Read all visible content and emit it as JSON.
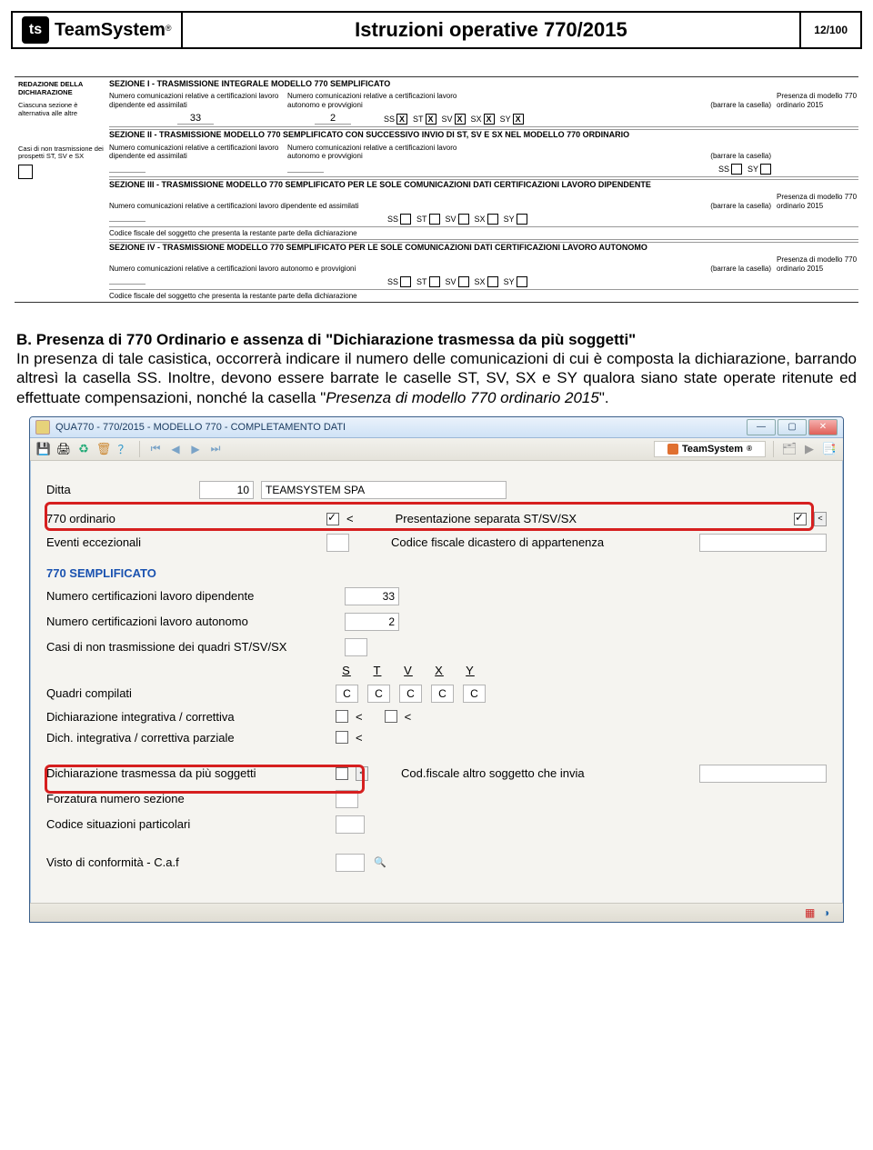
{
  "header": {
    "brand": "TeamSystem",
    "reg": "®",
    "title": "Istruzioni operative 770/2015",
    "page": "12/100"
  },
  "sidebar": {
    "heading": "REDAZIONE DELLA DICHIARAZIONE",
    "note1": "Ciascuna sezione è alternativa alle altre",
    "note2": "Casi di non trasmissione dei prospetti ST, SV e SX"
  },
  "form": {
    "sec1": {
      "title": "SEZIONE I - TRASMISSIONE INTEGRALE MODELLO 770 SEMPLIFICATO",
      "lbl1": "Numero comunicazioni relative a certificazioni lavoro dipendente ed assimilati",
      "val1": "33",
      "lbl2": "Numero comunicazioni relative a certificazioni lavoro autonomo e provvigioni",
      "val2": "2",
      "barrare": "(barrare la casella)",
      "presenza": "Presenza di modello 770 ordinario 2015",
      "ss": "SS",
      "st": "ST",
      "sv": "SV",
      "sx": "SX",
      "sy": "SY"
    },
    "sec2": {
      "title": "SEZIONE II - TRASMISSIONE MODELLO 770 SEMPLIFICATO CON SUCCESSIVO INVIO DI ST, SV E SX NEL MODELLO 770 ORDINARIO",
      "lbl1": "Numero comunicazioni relative a certificazioni lavoro dipendente ed assimilati",
      "lbl2": "Numero comunicazioni relative a certificazioni lavoro autonomo e provvigioni",
      "barrare": "(barrare la casella)"
    },
    "sec3": {
      "title": "SEZIONE III - TRASMISSIONE MODELLO 770 SEMPLIFICATO PER LE SOLE COMUNICAZIONI DATI CERTIFICAZIONI LAVORO DIPENDENTE",
      "lbl": "Numero comunicazioni relative a certificazioni lavoro dipendente ed assimilati",
      "barrare": "(barrare la casella)",
      "presenza": "Presenza di modello 770 ordinario 2015",
      "cf": "Codice fiscale del soggetto che presenta la restante parte della dichiarazione"
    },
    "sec4": {
      "title": "SEZIONE IV - TRASMISSIONE MODELLO 770 SEMPLIFICATO PER LE SOLE COMUNICAZIONI DATI CERTIFICAZIONI LAVORO AUTONOMO",
      "lbl": "Numero comunicazioni relative a certificazioni lavoro autonomo e provvigioni",
      "barrare": "(barrare la casella)",
      "presenza": "Presenza di modello 770 ordinario 2015",
      "cf": "Codice fiscale del soggetto che presenta la restante parte della dichiarazione"
    }
  },
  "body": {
    "lead": "B. Presenza di 770 Ordinario e assenza di \"Dichiarazione trasmessa da più soggetti\"",
    "text1": "In presenza di tale casistica, occorrerà indicare il numero delle comunicazioni di cui è composta la dichiarazione, barrando altresì la casella SS. Inoltre, devono essere barrate le caselle ST, SV, SX e SY qualora siano state operate ritenute ed effettuate compensazioni, nonché la casella \"",
    "italic": "Presenza di modello 770 ordinario 2015",
    "text2": "\"."
  },
  "app": {
    "title": "QUA770 - 770/2015 - MODELLO 770 - COMPLETAMENTO DATI",
    "brand": "TeamSystem",
    "fields": {
      "ditta_label": "Ditta",
      "ditta_num": "10",
      "ditta_name": "TEAMSYSTEM SPA",
      "ord_label": "770 ordinario",
      "ord_sep": "<",
      "pres_label": "Presentazione separata ST/SV/SX",
      "ev_label": "Eventi eccezionali",
      "cf_label": "Codice fiscale dicastero di appartenenza",
      "sec_title": "770 SEMPLIFICATO",
      "cert_dip_label": "Numero certificazioni lavoro dipendente",
      "cert_dip_val": "33",
      "cert_aut_label": "Numero certificazioni lavoro autonomo",
      "cert_aut_val": "2",
      "casi_label": "Casi di non trasmissione dei quadri ST/SV/SX",
      "stvxy": {
        "s": "S",
        "t": "T",
        "v": "V",
        "x": "X",
        "y": "Y"
      },
      "quadri_label": "Quadri compilati",
      "c": "C",
      "dich_int_label": "Dichiarazione integrativa / correttiva",
      "dich_parz_label": "Dich. integrativa / correttiva parziale",
      "lt1": "<",
      "lt2": "<",
      "dich_tras_label": "Dichiarazione trasmessa da più soggetti",
      "cod_altro_label": "Cod.fiscale altro soggetto che invia",
      "forz_label": "Forzatura numero sezione",
      "sit_label": "Codice situazioni particolari",
      "visto_label": "Visto di conformità - C.a.f"
    }
  }
}
